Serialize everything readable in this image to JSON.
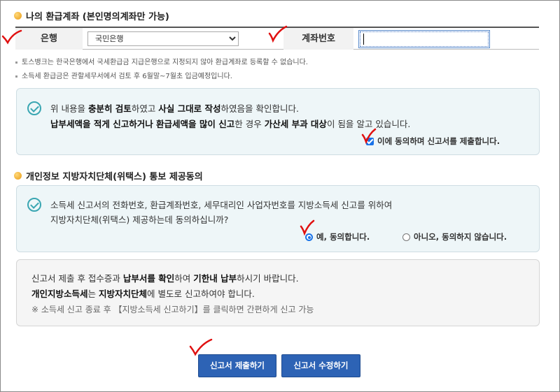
{
  "section1": {
    "title": "나의 환급계좌 (본인명의계좌만 가능)",
    "bank_label": "은행",
    "bank_selected": "국민은행",
    "account_label": "계좌번호",
    "account_value": "",
    "notes": [
      "토스뱅크는 한국은행에서 국세환급금 지급은행으로 지정되지 않아 환급계좌로 등록할 수 없습니다.",
      "소득세 환급금은 관할세무서에서 검토 후 6월말~7월초 입금예정입니다."
    ]
  },
  "confirm_box": {
    "line1_a": "위 내용을 ",
    "line1_b": "충분히 검토",
    "line1_c": "하였고 ",
    "line1_d": "사실 그대로 작성",
    "line1_e": "하였음을 확인합니다.",
    "line2_a": "납부세액을 적게 신고하거나 환급세액을 많이 신고",
    "line2_b": "한 경우 ",
    "line2_c": "가산세 부과 대상",
    "line2_d": "이 됨을 알고 있습니다.",
    "agree_checkbox_label": "이에 동의하며 신고서를 제출합니다.",
    "agree_checked": true
  },
  "section2": {
    "title": "개인정보 지방자치단체(위택스) 통보 제공동의",
    "line1": "소득세 신고서의 전화번호, 환급계좌번호, 세무대리인 사업자번호를 지방소득세 신고를 위하여",
    "line2": "지방자치단체(위택스) 제공하는데 동의하십니까?",
    "yes_label": "예, 동의합니다.",
    "no_label": "아니오, 동의하지 않습니다.",
    "selected": "yes"
  },
  "info_box": {
    "line1_a": "신고서 제출 후 접수증과 ",
    "line1_b": "납부서를 확인",
    "line1_c": "하여 ",
    "line1_d": "기한내 납부",
    "line1_e": "하시기 바랍니다.",
    "line2_a": "개인지방소득세",
    "line2_b": "는 ",
    "line2_c": "지방자치단체",
    "line2_d": "에 별도로 신고하여야 합니다.",
    "line3": "※ 소득세 신고 종료 후 【지방소득세 신고하기】를 클릭하면 간편하게 신고 가능"
  },
  "buttons": {
    "submit_label": "신고서 제출하기",
    "edit_label": "신고서 수정하기"
  },
  "colors": {
    "accent_blue": "#2d63b5",
    "check_teal": "#3aa6b2",
    "annotation_red": "#e01010"
  }
}
